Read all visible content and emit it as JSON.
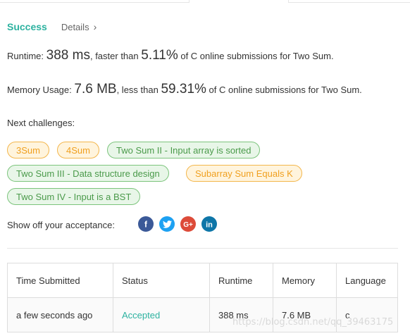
{
  "header": {
    "status": "Success",
    "details_label": "Details"
  },
  "runtime": {
    "label": "Runtime:",
    "value": "388 ms",
    "mid": ", faster than",
    "percent": "5.11%",
    "suffix": "of C online submissions for Two Sum."
  },
  "memory": {
    "label": "Memory Usage:",
    "value": "7.6 MB",
    "mid": ", less than",
    "percent": "59.31%",
    "suffix": "of C online submissions for Two Sum."
  },
  "next": {
    "label": "Next challenges:",
    "chips": [
      {
        "label": "3Sum",
        "color": "orange"
      },
      {
        "label": "4Sum",
        "color": "orange"
      },
      {
        "label": "Two Sum II - Input array is sorted",
        "color": "green"
      },
      {
        "label": "Two Sum III - Data structure design",
        "color": "green"
      },
      {
        "label": "Subarray Sum Equals K",
        "color": "orange"
      },
      {
        "label": "Two Sum IV - Input is a BST",
        "color": "green"
      }
    ]
  },
  "share": {
    "label": "Show off your acceptance:",
    "icons": [
      "facebook-icon",
      "twitter-icon",
      "google-plus-icon",
      "linkedin-icon"
    ]
  },
  "table": {
    "headers": [
      "Time Submitted",
      "Status",
      "Runtime",
      "Memory",
      "Language"
    ],
    "rows": [
      [
        "a few seconds ago",
        "Accepted",
        "388 ms",
        "7.6 MB",
        "c"
      ]
    ]
  },
  "watermark": "https://blog.csdn.net/qq_39463175",
  "colors": {
    "accent": "#2db2a0",
    "chip_orange": "#f0a020",
    "chip_green": "#4a9a4a"
  }
}
